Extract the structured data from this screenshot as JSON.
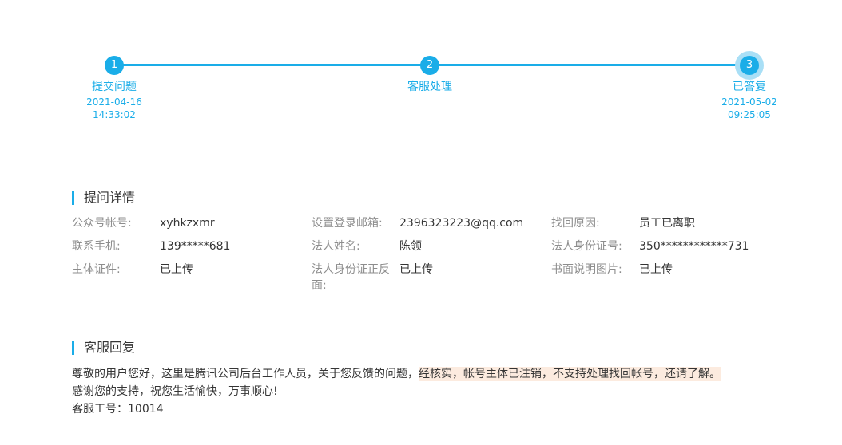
{
  "steps": [
    {
      "num": "1",
      "label": "提交问题",
      "date": "2021-04-16",
      "time": "14:33:02"
    },
    {
      "num": "2",
      "label": "客服处理"
    },
    {
      "num": "3",
      "label": "已答复",
      "date": "2021-05-02",
      "time": "09:25:05"
    }
  ],
  "progress": {
    "completed_steps": 3,
    "total_steps": 3
  },
  "details": {
    "title": "提问详情",
    "account_label": "公众号帐号:",
    "account_value": "xyhkzxmr",
    "email_label": "设置登录邮箱:",
    "email_value": "2396323223@qq.com",
    "reason_label": "找回原因:",
    "reason_value": "员工已离职",
    "phone_label": "联系手机:",
    "phone_value": "139*****681",
    "legal_name_label": "法人姓名:",
    "legal_name_value": "陈领",
    "legal_id_label": "法人身份证号:",
    "legal_id_value": "350************731",
    "entity_doc_label": "主体证件:",
    "entity_doc_value": "已上传",
    "id_photo_label": "法人身份证正反面:",
    "id_photo_value": "已上传",
    "written_img_label": "书面说明图片:",
    "written_img_value": "已上传"
  },
  "reply": {
    "title": "客服回复",
    "line1_prefix": "尊敬的用户您好，这里是腾讯公司后台工作人员，关于您反馈的问题，",
    "line1_highlight": "经核实，帐号主体已注销，不支持处理找回帐号，还请了解。",
    "line2": "感谢您的支持，祝您生活愉快，万事顺心!",
    "line3": "客服工号：10014"
  },
  "colors": {
    "accent": "#1aade8",
    "highlight": "#fcebdf",
    "label_gray": "#8d8d8d",
    "text": "#353535"
  }
}
